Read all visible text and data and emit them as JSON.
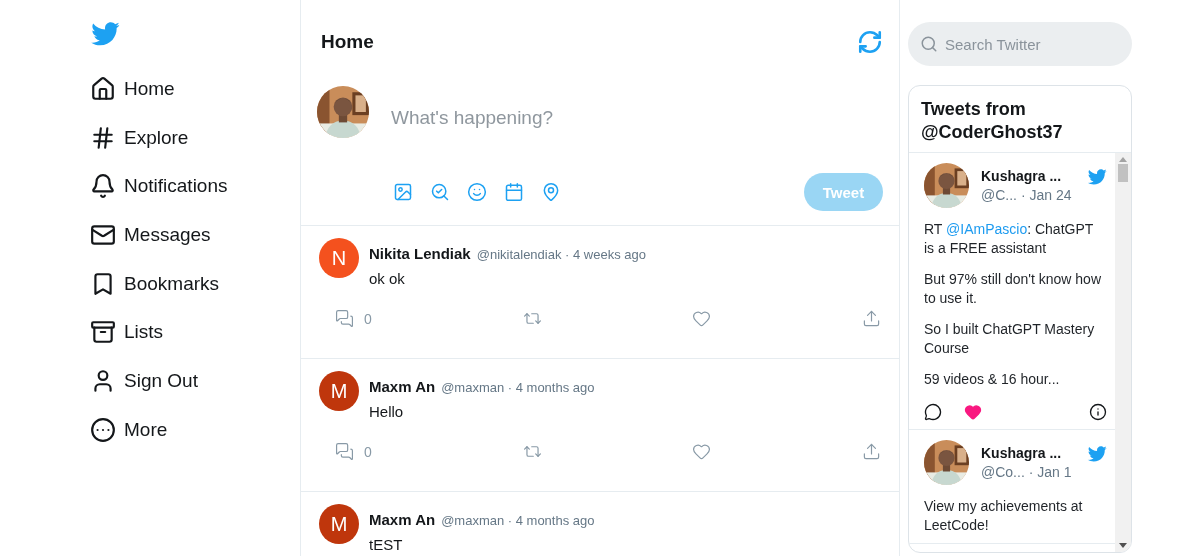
{
  "nav": [
    {
      "label": "Home"
    },
    {
      "label": "Explore"
    },
    {
      "label": "Notifications"
    },
    {
      "label": "Messages"
    },
    {
      "label": "Bookmarks"
    },
    {
      "label": "Lists"
    },
    {
      "label": "Sign Out"
    },
    {
      "label": "More"
    }
  ],
  "header": {
    "title": "Home"
  },
  "composer": {
    "placeholder": "What's happening?",
    "button": {
      "label": "Tweet",
      "disabled": true
    }
  },
  "tweets": [
    {
      "initial": "N",
      "color": "#f4511e",
      "name": "Nikita Lendiak",
      "meta": "@nikitalendiak · 4 weeks ago",
      "text": "ok ok",
      "replies": "0"
    },
    {
      "initial": "M",
      "color": "#bf360c",
      "name": "Maxm An",
      "meta": "@maxman · 4 months ago",
      "text": "Hello",
      "replies": "0"
    },
    {
      "initial": "M",
      "color": "#bf360c",
      "name": "Maxm An",
      "meta": "@maxman · 4 months ago",
      "text": "tEST"
    }
  ],
  "search": {
    "placeholder": "Search Twitter"
  },
  "widget": {
    "title": "Tweets from @CoderGhost37",
    "tweets": [
      {
        "name": "Kushagra ...",
        "meta": "@C... · Jan 24",
        "liked": true,
        "paragraphs": [
          [
            {
              "kind": "plain",
              "text": "RT "
            },
            {
              "kind": "mention",
              "text": "@IAmPascio"
            },
            {
              "kind": "plain",
              "text": ": ChatGPT is a FREE assistant"
            }
          ],
          [
            {
              "kind": "plain",
              "text": "But 97% still don't know how to use it."
            }
          ],
          [
            {
              "kind": "plain",
              "text": "So I built ChatGPT Mastery Course"
            }
          ],
          [
            {
              "kind": "plain",
              "text": "59 videos & 16 hour..."
            }
          ]
        ]
      },
      {
        "name": "Kushagra ...",
        "meta": "@Co... · Jan 1",
        "paragraphs": [
          [
            {
              "kind": "plain",
              "text": "View my achievements at LeetCode!"
            }
          ]
        ]
      }
    ]
  }
}
